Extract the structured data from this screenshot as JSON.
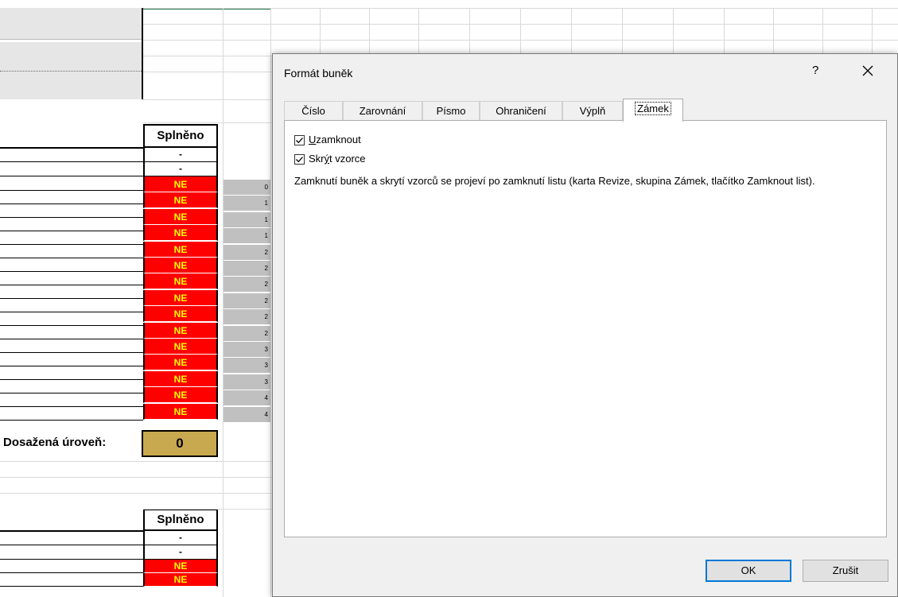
{
  "sheet": {
    "header_label": "Splněno",
    "dash": "-",
    "ne_value": "NE",
    "side_numbers": [
      "0",
      "1",
      "1",
      "1",
      "2",
      "2",
      "2",
      "2",
      "2",
      "2",
      "3",
      "3",
      "3",
      "4",
      "4"
    ],
    "achieved_label": "Dosažená úroveň:",
    "achieved_value": "0",
    "colors": {
      "ne_bg": "#ff0000",
      "ne_text": "#ffff00",
      "achieved_bg": "#c9a94f",
      "side_bg": "#c0c0c0"
    }
  },
  "dialog": {
    "title": "Formát buněk",
    "help": "?",
    "close": "✕",
    "tabs": [
      "Číslo",
      "Zarovnání",
      "Písmo",
      "Ohraničení",
      "Výplň",
      "Zámek"
    ],
    "active_tab": "Zámek",
    "lock_checkbox": {
      "label_ul": "U",
      "label_rest": "zamknout",
      "checked": true
    },
    "hide_checkbox": {
      "label_pre": "Skr",
      "label_ul": "ý",
      "label_rest": "t vzorce",
      "checked": true
    },
    "note": "Zamknutí buněk a skrytí vzorců se projeví po zamknutí listu (karta Revize, skupina Zámek, tlačítko Zamknout list).",
    "ok": "OK",
    "cancel": "Zrušit"
  }
}
